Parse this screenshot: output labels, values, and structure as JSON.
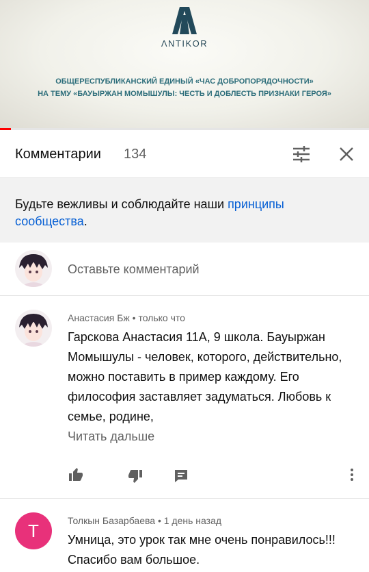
{
  "video": {
    "logo_text": "ΛNTIKOR",
    "banner_line1": "ОБЩЕРЕСПУБЛИКАНСКИЙ ЕДИНЫЙ «ЧАС ДОБРОПОРЯДОЧНОСТИ»",
    "banner_line2": "НА ТЕМУ «БАУЫРЖАН МОМЫШУЛЫ: ЧЕСТЬ И ДОБЛЕСТЬ ПРИЗНАКИ ГЕРОЯ»",
    "progress_fraction": 0.03
  },
  "header": {
    "title": "Комментарии",
    "count": "134"
  },
  "notice": {
    "text": "Будьте вежливы и соблюдайте наши ",
    "link": "принципы сообщества",
    "suffix": "."
  },
  "add_comment": {
    "placeholder": "Оставьте комментарий"
  },
  "comments": [
    {
      "author": "Анастасия Бж",
      "time": "только что",
      "text": "Гарскова Анастасия 11А, 9 школа. Бауыржан Момышулы - человек, которого, действительно, можно поставить в пример каждому. Его философия заставляет задуматься. Любовь к семье, родине,",
      "read_more": "Читать дальше"
    },
    {
      "author": "Толкын Базарбаева",
      "time": "1 день назад",
      "avatar_letter": "Т",
      "text": "Умница, это урок так мне очень понравилось!!! Спасибо вам большое."
    }
  ],
  "colors": {
    "accent_link": "#065fd4",
    "progress": "#ff0000",
    "avatar_pink": "#e8317a"
  }
}
